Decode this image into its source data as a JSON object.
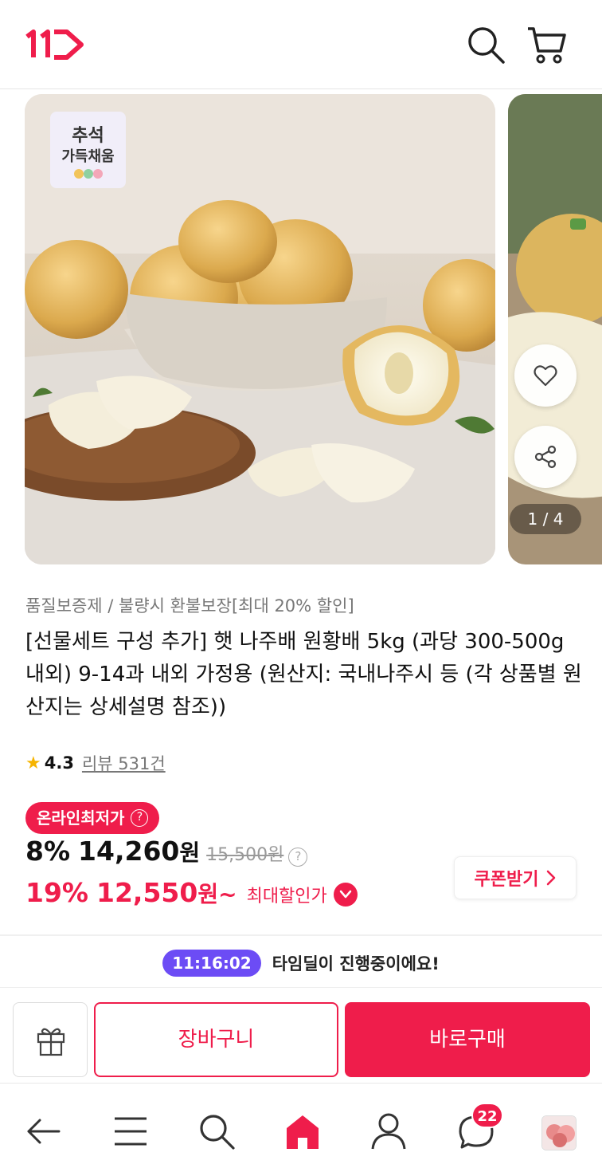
{
  "header": {
    "logo_text": "11",
    "search_icon": "search-icon",
    "cart_icon": "cart-icon"
  },
  "gallery": {
    "badge_line1": "추석",
    "badge_line2": "가득채움",
    "counter": "1 / 4"
  },
  "product": {
    "subtitle": "품질보증제 / 불량시 환불보장[최대 20% 할인]",
    "title": "[선물세트 구성 추가] 햇 나주배 원황배 5kg (과당 300-500g 내외) 9-14과 내외 가정용 (원산지: 국내나주시 등 (각 상품별 원산지는 상세설명 참조))",
    "rating": "4.3",
    "reviews": "리뷰 531건"
  },
  "pricing": {
    "lowest_badge": "온라인최저가",
    "sale_pct": "8%",
    "sale_price": "14,260",
    "unit": "원",
    "original_price": "15,500원",
    "max_pct": "19%",
    "max_price": "12,550",
    "max_unit": "원~",
    "max_label": "최대할인가",
    "coupon_label": "쿠폰받기"
  },
  "timedeal": {
    "timer": "11:16:02",
    "text": "타임딜이 진행중이에요!"
  },
  "actions": {
    "cart_label": "장바구니",
    "buy_label": "바로구매"
  },
  "nav": {
    "chat_badge": "22"
  },
  "colors": {
    "brand": "#ef1d4b",
    "timer": "#6c4cf5",
    "star": "#f6b400"
  }
}
